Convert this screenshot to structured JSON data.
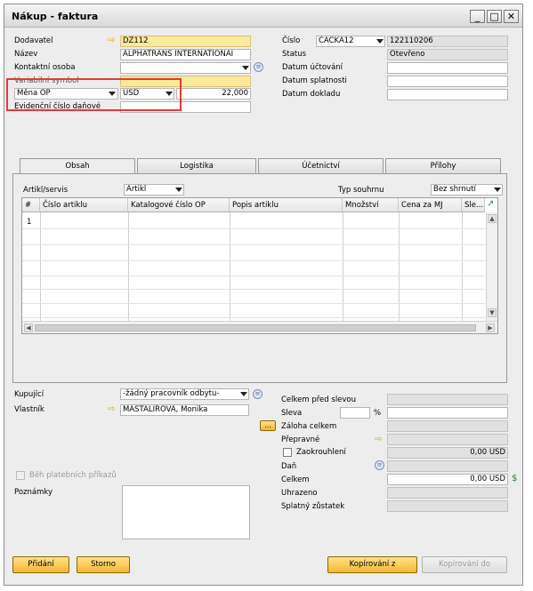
{
  "window": {
    "title": "Nákup - faktura"
  },
  "header_left": {
    "vendor_label": "Dodavatel",
    "vendor_value": "DZ112",
    "name_label": "Název",
    "name_value": "ALPHATRANS INTERNATIONAI",
    "contact_label": "Kontaktní osoba",
    "contact_value": "",
    "var_symbol_label": "Variabilní symbol",
    "currency_label": "Měna OP",
    "currency_value": "USD",
    "amount_value": "22,000",
    "tax_doc_label": "Evidenční číslo daňové"
  },
  "header_right": {
    "number_label": "Číslo",
    "series_value": "CACKA12",
    "number_value": "122110206",
    "status_label": "Status",
    "status_value": "Otevřeno",
    "posting_label": "Datum účtování",
    "due_label": "Datum splatnosti",
    "doc_date_label": "Datum dokladu"
  },
  "tabs": [
    "Obsah",
    "Logistika",
    "Účetnictví",
    "Přílohy"
  ],
  "content": {
    "item_type_label": "Artikl/servis",
    "item_type_value": "Artikl",
    "summary_label": "Typ souhrnu",
    "summary_value": "Bez shrnutí",
    "columns": [
      "#",
      "Číslo artiklu",
      "Katalogové číslo OP",
      "Popis artiklu",
      "Množství",
      "Cena za MJ",
      "Sle..."
    ],
    "rows": [
      "1"
    ]
  },
  "footer_left": {
    "buyer_label": "Kupující",
    "buyer_value": "-žádný pracovník odbytu-",
    "owner_label": "Vlastník",
    "owner_value": "MAŠTALÍŘOVÁ, Monika",
    "payment_run_label": "Běh platebních příkazů",
    "remarks_label": "Poznámky"
  },
  "footer_right": {
    "before_discount_label": "Celkem před slevou",
    "discount_label": "Sleva",
    "percent_sign": "%",
    "down_payment_label": "Záloha celkem",
    "freight_label": "Přepravné",
    "rounding_label": "Zaokrouhlení",
    "rounding_value": "0,00 USD",
    "tax_label": "Daň",
    "total_label": "Celkem",
    "total_value": "0,00 USD",
    "paid_label": "Uhrazeno",
    "balance_label": "Splatný zůstatek"
  },
  "buttons": {
    "add": "Přidání",
    "cancel": "Storno",
    "copy_to": "Kopírování z",
    "copy_from": "Kopírování do"
  },
  "colors": {
    "required_yellow": "#fbe99c",
    "button_orange": "#f3b833",
    "highlight_red": "#e53935"
  }
}
